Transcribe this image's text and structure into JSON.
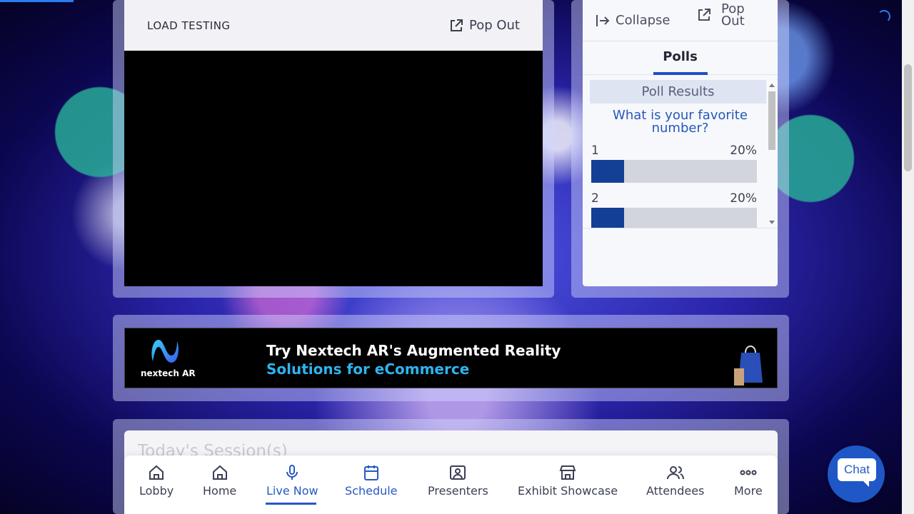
{
  "video": {
    "title": "LOAD TESTING",
    "popout_label": "Pop Out"
  },
  "side_panel": {
    "collapse_label": "Collapse",
    "popout_line1": "Pop",
    "popout_line2": "Out",
    "tab_label": "Polls",
    "poll": {
      "header": "Poll Results",
      "question": "What is your favorite number?",
      "options": [
        {
          "label": "1",
          "percent_text": "20%",
          "percent": 20
        },
        {
          "label": "2",
          "percent_text": "20%",
          "percent": 20
        }
      ]
    }
  },
  "banner": {
    "logo_text": "nextech AR",
    "line1": "Try Nextech AR's Augmented Reality",
    "line2": "Solutions for eCommerce"
  },
  "sessions": {
    "title": "Today's Session(s)"
  },
  "nav": {
    "items": [
      {
        "label": "Lobby",
        "icon": "home-icon",
        "active": false
      },
      {
        "label": "Home",
        "icon": "home-icon",
        "active": false
      },
      {
        "label": "Live Now",
        "icon": "microphone-icon",
        "active": true
      },
      {
        "label": "Schedule",
        "icon": "calendar-icon",
        "active": true
      },
      {
        "label": "Presenters",
        "icon": "presenter-icon",
        "active": false
      },
      {
        "label": "Exhibit Showcase",
        "icon": "storefront-icon",
        "active": false
      },
      {
        "label": "Attendees",
        "icon": "people-icon",
        "active": false
      },
      {
        "label": "More",
        "icon": "ellipsis-icon",
        "active": false
      }
    ]
  },
  "chat": {
    "label": "Chat"
  },
  "colors": {
    "accent": "#2659c4",
    "poll_bar": "#133f94",
    "banner_highlight": "#2fb3ee"
  }
}
